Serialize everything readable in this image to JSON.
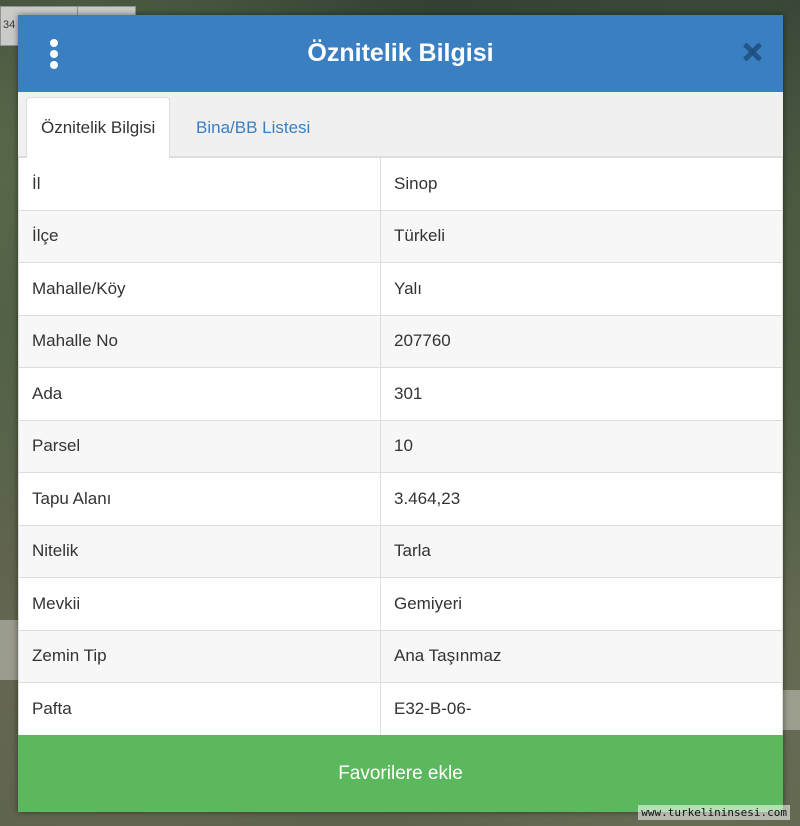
{
  "background": {
    "scale_text": "34",
    "watermark": "www.turkelininsesi.com"
  },
  "modal": {
    "title": "Öznitelik Bilgisi",
    "menu_icon": "vertical-ellipsis-icon",
    "close_icon": "close-icon",
    "header_color": "#3a7fc1"
  },
  "tabs": [
    {
      "label": "Öznitelik Bilgisi",
      "active": true
    },
    {
      "label": "Bina/BB Listesi",
      "active": false
    }
  ],
  "attributes": [
    {
      "key": "İl",
      "value": "Sinop"
    },
    {
      "key": "İlçe",
      "value": "Türkeli"
    },
    {
      "key": "Mahalle/Köy",
      "value": "Yalı"
    },
    {
      "key": "Mahalle No",
      "value": "207760"
    },
    {
      "key": "Ada",
      "value": "301"
    },
    {
      "key": "Parsel",
      "value": "10"
    },
    {
      "key": "Tapu Alanı",
      "value": "3.464,23"
    },
    {
      "key": "Nitelik",
      "value": "Tarla"
    },
    {
      "key": "Mevkii",
      "value": "Gemiyeri"
    },
    {
      "key": "Zemin Tip",
      "value": "Ana Taşınmaz"
    },
    {
      "key": "Pafta",
      "value": "E32-B-06-"
    }
  ],
  "footer": {
    "button_label": "Favorilere ekle",
    "button_color": "#5cb85c"
  }
}
